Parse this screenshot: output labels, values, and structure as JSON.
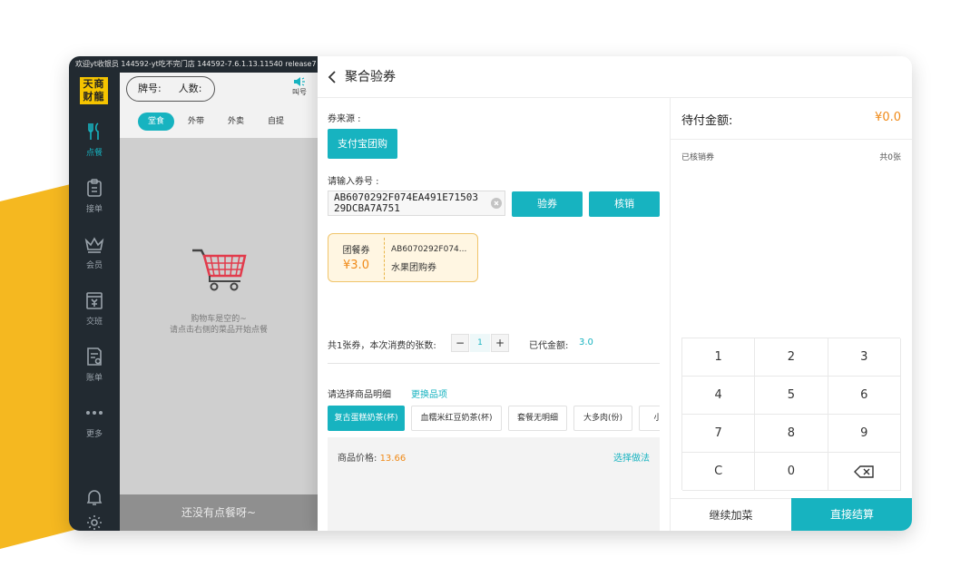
{
  "status_bar": "欢迎yt收银员  144592-yt吃不完门店  144592-7.6.1.13.11540  release7",
  "brand": {
    "logo_text": "天商财龍",
    "logo_color": "#f5c400"
  },
  "colors": {
    "accent": "#17b3c0",
    "price": "#f08a18",
    "sidebar_bg": "#222a31"
  },
  "sidebar": {
    "items": [
      {
        "label": "点餐",
        "icon": "fork-knife-icon",
        "active": true
      },
      {
        "label": "接单",
        "icon": "clipboard-icon"
      },
      {
        "label": "会员",
        "icon": "crown-icon"
      },
      {
        "label": "交班",
        "icon": "cash-register-icon"
      },
      {
        "label": "账单",
        "icon": "bill-icon"
      },
      {
        "label": "更多",
        "icon": "more-dots-icon"
      }
    ],
    "bottom_icons": [
      "bell-icon",
      "gear-icon"
    ]
  },
  "order": {
    "table_label": "牌号:",
    "guests_label": "人数:",
    "call_label": "叫号",
    "tabs": [
      {
        "label": "堂食",
        "active": true
      },
      {
        "label": "外带"
      },
      {
        "label": "外卖"
      },
      {
        "label": "自提"
      }
    ],
    "empty_line1": "购物车是空的~",
    "empty_line2": "请点击右侧的菜品开始点餐",
    "footer": "还没有点餐呀~"
  },
  "dialog": {
    "title": "聚合验券",
    "source_label": "券来源 :",
    "source_button": "支付宝团购",
    "input_label": "请输入券号 :",
    "coupon_code": "AB6070292F074EA491E7150329DCBA7A751",
    "verify_button": "验券",
    "redeem_button": "核销",
    "ticket": {
      "type": "团餐券",
      "price": "¥3.0",
      "code": "AB6070292F074...",
      "name": "水果团购券"
    },
    "count_text": "共1张券，本次消费的张数:",
    "quantity": "1",
    "minus": "−",
    "plus": "+",
    "paid_label": "已代金额:",
    "paid_value": "3.0",
    "select_label": "请选择商品明细",
    "change_link": "更换品项",
    "items": [
      {
        "label": "复古蛋糕奶茶(杯)",
        "active": true
      },
      {
        "label": "血糯米红豆奶茶(杯)"
      },
      {
        "label": "套餐无明细"
      },
      {
        "label": "大多肉(份)"
      },
      {
        "label": "小多肉"
      }
    ],
    "price_label": "商品价格:",
    "price_value": "13.66",
    "method_link": "选择做法"
  },
  "payment": {
    "due_label": "待付金额:",
    "due_amount": "¥0.0",
    "used_label": "已核销券",
    "used_count": "共0张",
    "keys": [
      "1",
      "2",
      "3",
      "4",
      "5",
      "6",
      "7",
      "8",
      "9",
      "C",
      "0",
      "backspace"
    ],
    "continue_button": "继续加菜",
    "checkout_button": "直接结算"
  }
}
